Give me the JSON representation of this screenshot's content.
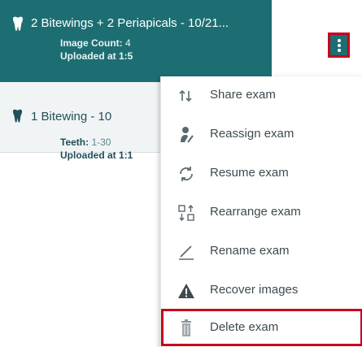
{
  "exams": [
    {
      "title": "2 Bitewings + 2 Periapicals - 10/21...",
      "meta1_key": "Image Count:",
      "meta1_val": "4",
      "meta2_key": "Uploaded at 1:5",
      "meta2_val": ""
    },
    {
      "title": "1 Bitewing - 10",
      "meta1_key": "Teeth:",
      "meta1_val": "1-30",
      "meta2_key": "Uploaded at 1:1",
      "meta2_val": ""
    }
  ],
  "icons": {
    "tooth": "tooth-icon",
    "kebab": "kebab-menu-icon"
  },
  "menu": {
    "items": [
      {
        "label": "Share exam",
        "icon": "share-icon"
      },
      {
        "label": "Reassign exam",
        "icon": "reassign-icon"
      },
      {
        "label": "Resume exam",
        "icon": "resume-icon"
      },
      {
        "label": "Rearrange exam",
        "icon": "rearrange-icon"
      },
      {
        "label": "Rename exam",
        "icon": "rename-icon"
      },
      {
        "label": "Recover images",
        "icon": "warning-icon"
      },
      {
        "label": "Delete exam",
        "icon": "trash-icon"
      }
    ]
  },
  "colors": {
    "selected_bg": "#1d6e72",
    "highlight": "#c8001a"
  }
}
